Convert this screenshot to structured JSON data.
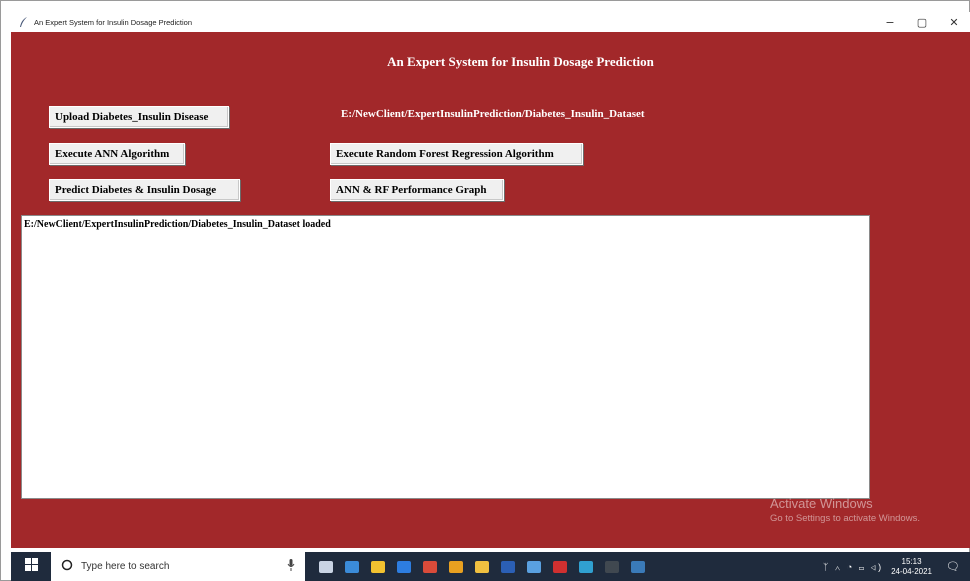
{
  "window": {
    "title": "An Expert System for Insulin Dosage Prediction",
    "controls": {
      "minimize": "−",
      "maximize": "▢",
      "close": "✕"
    }
  },
  "app": {
    "heading": "An Expert System for Insulin Dosage Prediction",
    "buttons": {
      "upload": "Upload Diabetes_Insulin Disease",
      "ann": "Execute ANN Algorithm",
      "rf": "Execute Random Forest Regression Algorithm",
      "predict": "Predict Diabetes & Insulin Dosage",
      "graph": "ANN & RF Performance Graph"
    },
    "path_label": "E:/NewClient/ExpertInsulinPrediction/Diabetes_Insulin_Dataset",
    "output_text": "E:/NewClient/ExpertInsulinPrediction/Diabetes_Insulin_Dataset loaded"
  },
  "activation_watermark": {
    "line1": "Activate Windows",
    "line2": "Go to Settings to activate Windows."
  },
  "taskbar": {
    "search_placeholder": "Type here to search",
    "time": "15:13",
    "date": "24-04-2021",
    "icons": [
      "task-view",
      "mail",
      "store",
      "edge",
      "photos",
      "chrome",
      "file-explorer",
      "word",
      "notepad",
      "paint",
      "media",
      "terminal",
      "python"
    ],
    "icon_colors": [
      "#c9d4e4",
      "#3b8bd8",
      "#f2c230",
      "#2d7de0",
      "#d94b3a",
      "#e8a020",
      "#f0c040",
      "#2b5fb5",
      "#5aa0e0",
      "#d03030",
      "#30a0d0",
      "#404850",
      "#3a7ab8"
    ]
  },
  "colors": {
    "background": "#a2282a",
    "button": "#f0f0f0",
    "taskbar": "#1f2b3d"
  }
}
